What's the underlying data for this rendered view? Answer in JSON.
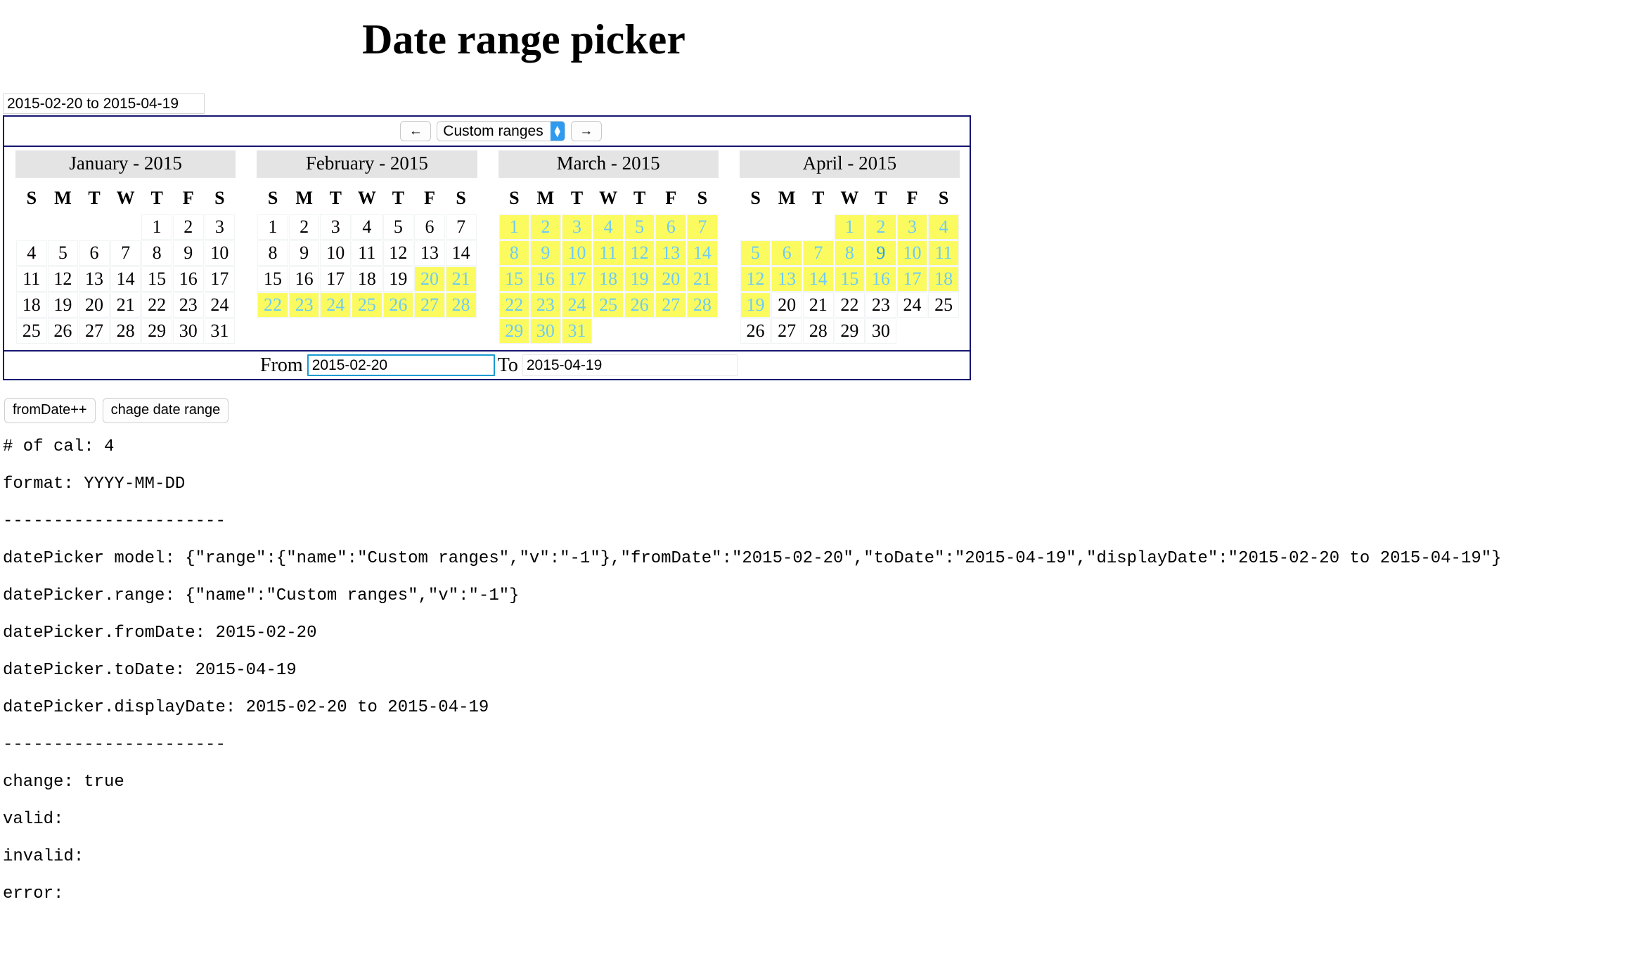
{
  "page": {
    "title": "Date range picker"
  },
  "display": {
    "value": "2015-02-20 to 2015-04-19",
    "placeholder": ""
  },
  "toolbar": {
    "prev_label": "←",
    "next_label": "→",
    "range_selected": "Custom ranges",
    "range_options": [
      "Custom ranges"
    ]
  },
  "calendars": [
    {
      "title": "January - 2015",
      "weekdays": [
        "S",
        "M",
        "T",
        "W",
        "T",
        "F",
        "S"
      ],
      "weeks": [
        [
          null,
          null,
          null,
          null,
          1,
          2,
          3
        ],
        [
          4,
          5,
          6,
          7,
          8,
          9,
          10
        ],
        [
          11,
          12,
          13,
          14,
          15,
          16,
          17
        ],
        [
          18,
          19,
          20,
          21,
          22,
          23,
          24
        ],
        [
          25,
          26,
          27,
          28,
          29,
          30,
          31
        ]
      ],
      "selected": [],
      "today": null
    },
    {
      "title": "February - 2015",
      "weekdays": [
        "S",
        "M",
        "T",
        "W",
        "T",
        "F",
        "S"
      ],
      "weeks": [
        [
          1,
          2,
          3,
          4,
          5,
          6,
          7
        ],
        [
          8,
          9,
          10,
          11,
          12,
          13,
          14
        ],
        [
          15,
          16,
          17,
          18,
          19,
          20,
          21
        ],
        [
          22,
          23,
          24,
          25,
          26,
          27,
          28
        ]
      ],
      "selected": [
        20,
        21,
        22,
        23,
        24,
        25,
        26,
        27,
        28
      ],
      "today": null
    },
    {
      "title": "March - 2015",
      "weekdays": [
        "S",
        "M",
        "T",
        "W",
        "T",
        "F",
        "S"
      ],
      "weeks": [
        [
          1,
          2,
          3,
          4,
          5,
          6,
          7
        ],
        [
          8,
          9,
          10,
          11,
          12,
          13,
          14
        ],
        [
          15,
          16,
          17,
          18,
          19,
          20,
          21
        ],
        [
          22,
          23,
          24,
          25,
          26,
          27,
          28
        ],
        [
          29,
          30,
          31,
          null,
          null,
          null,
          null
        ]
      ],
      "selected": [
        1,
        2,
        3,
        4,
        5,
        6,
        7,
        8,
        9,
        10,
        11,
        12,
        13,
        14,
        15,
        16,
        17,
        18,
        19,
        20,
        21,
        22,
        23,
        24,
        25,
        26,
        27,
        28,
        29,
        30,
        31
      ],
      "today": null
    },
    {
      "title": "April - 2015",
      "weekdays": [
        "S",
        "M",
        "T",
        "W",
        "T",
        "F",
        "S"
      ],
      "weeks": [
        [
          null,
          null,
          null,
          1,
          2,
          3,
          4
        ],
        [
          5,
          6,
          7,
          8,
          9,
          10,
          11
        ],
        [
          12,
          13,
          14,
          15,
          16,
          17,
          18
        ],
        [
          19,
          20,
          21,
          22,
          23,
          24,
          25
        ],
        [
          26,
          27,
          28,
          29,
          30,
          null,
          null
        ]
      ],
      "selected": [
        1,
        2,
        3,
        4,
        5,
        6,
        7,
        8,
        9,
        10,
        11,
        12,
        13,
        14,
        15,
        16,
        17,
        18,
        19
      ],
      "today": 9
    }
  ],
  "fromto": {
    "from_label": "From",
    "from_value": "2015-02-20",
    "to_label": "To",
    "to_value": "2015-04-19"
  },
  "actions": {
    "from_date_plus": "fromDate++",
    "change_date_range": "chage date range"
  },
  "debug_lines": [
    "# of cal: 4",
    "format: YYYY-MM-DD",
    "----------------------",
    "datePicker model: {\"range\":{\"name\":\"Custom ranges\",\"v\":\"-1\"},\"fromDate\":\"2015-02-20\",\"toDate\":\"2015-04-19\",\"displayDate\":\"2015-02-20 to 2015-04-19\"}",
    "datePicker.range: {\"name\":\"Custom ranges\",\"v\":\"-1\"}",
    "datePicker.fromDate: 2015-02-20",
    "datePicker.toDate: 2015-04-19",
    "datePicker.displayDate: 2015-02-20 to 2015-04-19",
    "----------------------",
    "change: true",
    "valid:",
    "invalid:",
    "error:"
  ],
  "colors": {
    "panel_border": "#151570",
    "selected_bg": "#fbfb60",
    "selected_fg": "#6ecbf5",
    "today_fg": "#2aa3e8",
    "focus_border": "#1b9ad2",
    "select_arrow_bg": "#2e9bf0",
    "month_header_bg": "#e4e4e4"
  }
}
